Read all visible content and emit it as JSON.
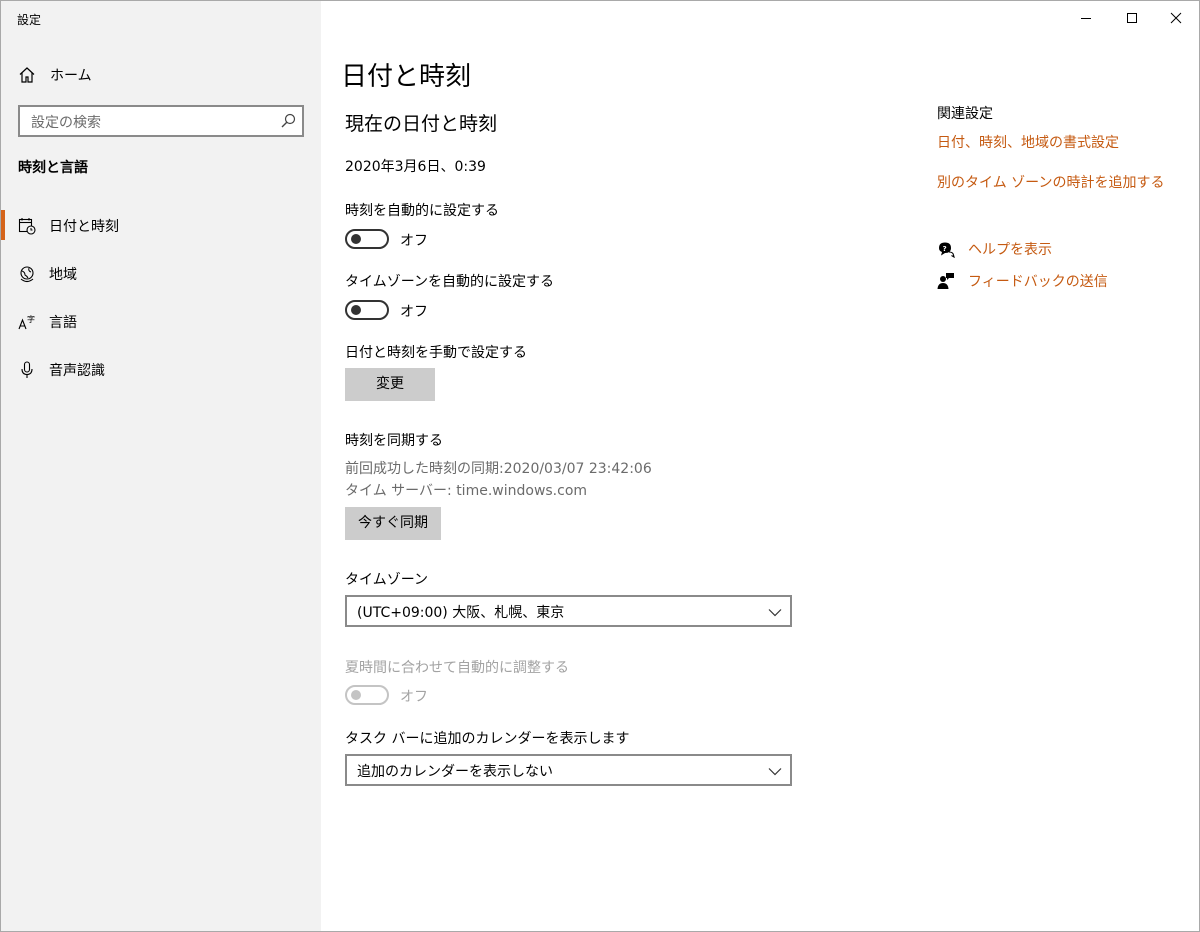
{
  "window": {
    "title": "設定"
  },
  "sidebar": {
    "home_label": "ホーム",
    "search_placeholder": "設定の検索",
    "section_title": "時刻と言語",
    "items": [
      {
        "label": "日付と時刻",
        "icon": "calendar-clock-icon",
        "active": true
      },
      {
        "label": "地域",
        "icon": "globe-icon",
        "active": false
      },
      {
        "label": "言語",
        "icon": "language-icon",
        "active": false
      },
      {
        "label": "音声認識",
        "icon": "microphone-icon",
        "active": false
      }
    ]
  },
  "main": {
    "page_title": "日付と時刻",
    "current_heading": "現在の日付と時刻",
    "current_datetime": "2020年3月6日、0:39",
    "auto_time": {
      "label": "時刻を自動的に設定する",
      "state": "オフ"
    },
    "auto_timezone": {
      "label": "タイムゾーンを自動的に設定する",
      "state": "オフ"
    },
    "manual": {
      "label": "日付と時刻を手動で設定する",
      "button": "変更"
    },
    "sync": {
      "label": "時刻を同期する",
      "last_sync": "前回成功した時刻の同期:2020/03/07 23:42:06",
      "server": "タイム サーバー: time.windows.com",
      "button": "今すぐ同期"
    },
    "timezone": {
      "label": "タイムゾーン",
      "value": "(UTC+09:00) 大阪、札幌、東京"
    },
    "dst": {
      "label": "夏時間に合わせて自動的に調整する",
      "state": "オフ"
    },
    "calendar": {
      "label": "タスク バーに追加のカレンダーを表示します",
      "value": "追加のカレンダーを表示しない"
    }
  },
  "related": {
    "title": "関連設定",
    "links": [
      "日付、時刻、地域の書式設定",
      "別のタイム ゾーンの時計を追加する"
    ],
    "help": "ヘルプを表示",
    "feedback": "フィードバックの送信"
  },
  "colors": {
    "accent": "#d4631a",
    "link": "#c55a11",
    "sidebar_bg": "#f2f2f2",
    "button_bg": "#cccccc"
  }
}
